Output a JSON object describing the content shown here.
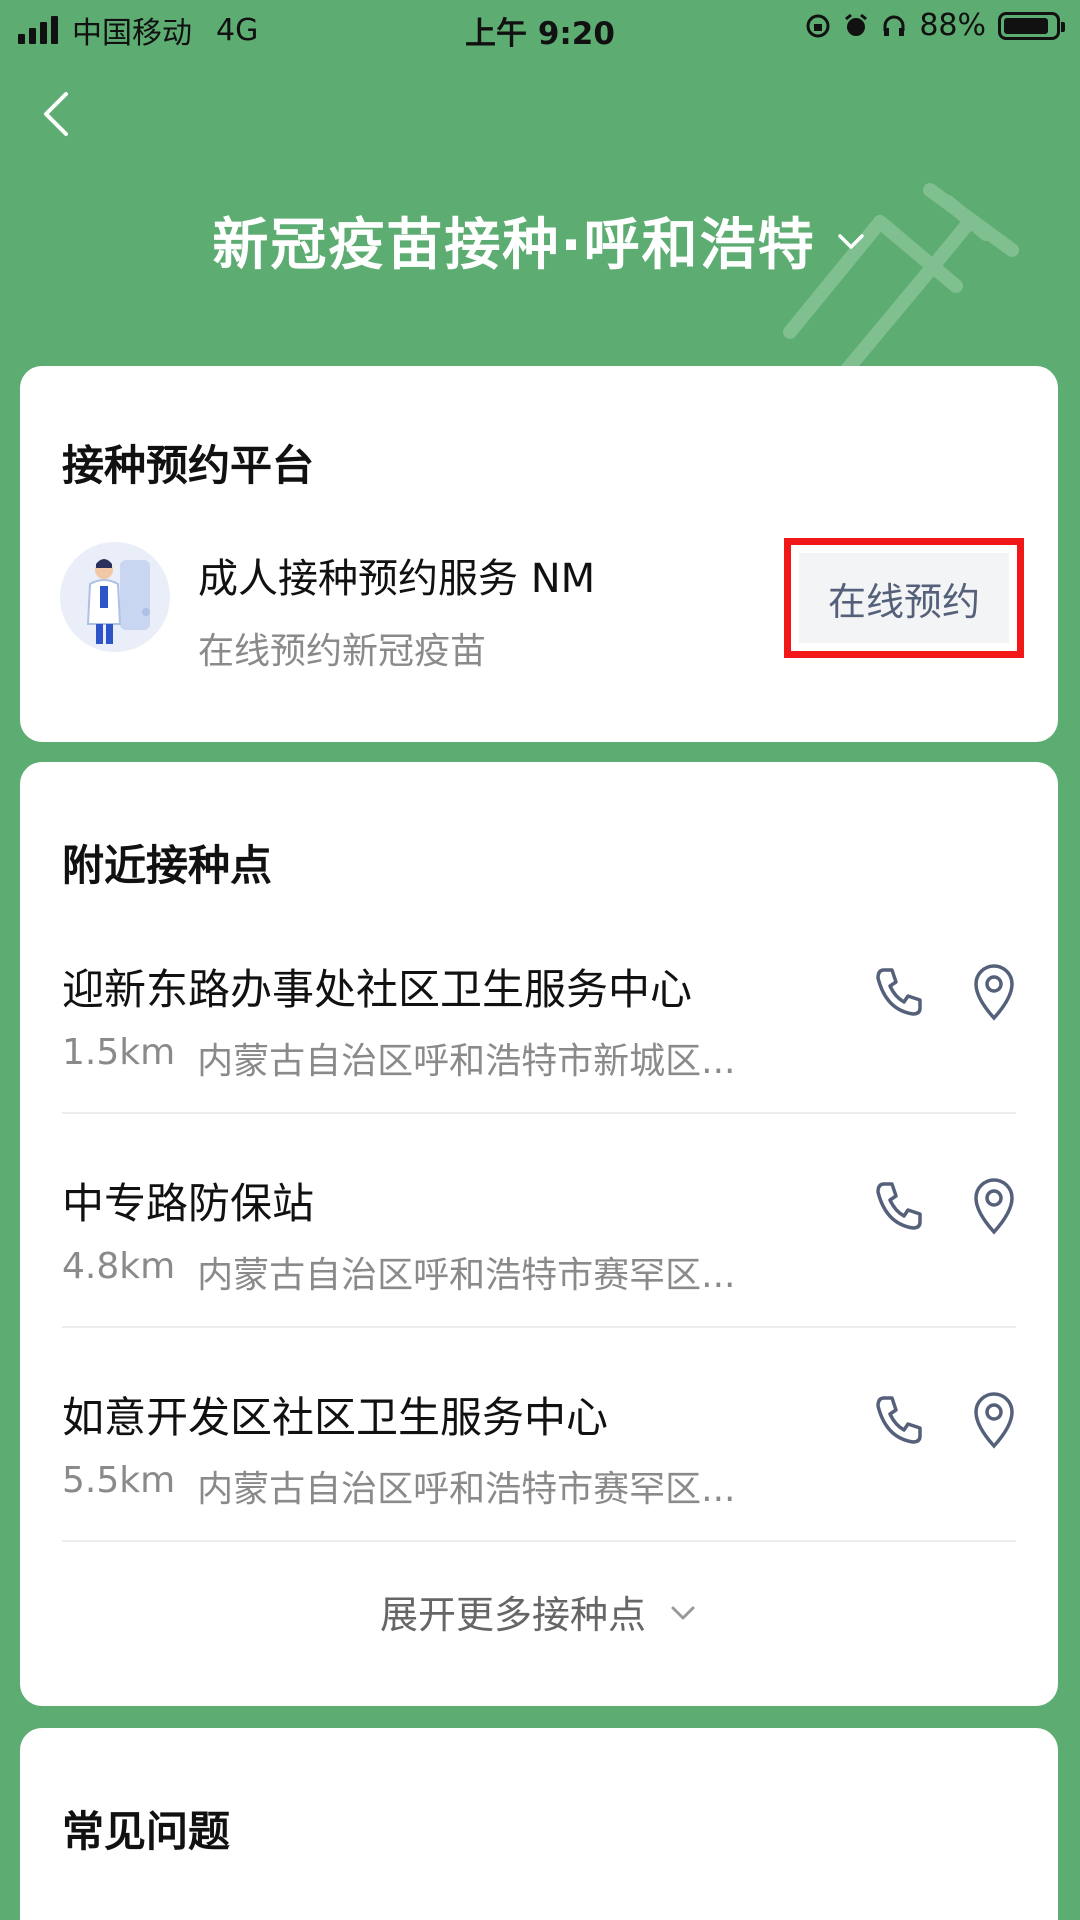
{
  "status_bar": {
    "carrier": "中国移动",
    "network": "4G",
    "time": "上午 9:20",
    "battery": "88%"
  },
  "header": {
    "title": "新冠疫苗接种·呼和浩特"
  },
  "booking": {
    "section_title": "接种预约平台",
    "service_name": "成人接种预约服务 NM",
    "service_desc": "在线预约新冠疫苗",
    "button_label": "在线预约"
  },
  "nearby": {
    "section_title": "附近接种点",
    "sites": [
      {
        "name": "迎新东路办事处社区卫生服务中心",
        "distance": "1.5km",
        "address": "内蒙古自治区呼和浩特市新城区..."
      },
      {
        "name": "中专路防保站",
        "distance": "4.8km",
        "address": "内蒙古自治区呼和浩特市赛罕区..."
      },
      {
        "name": "如意开发区社区卫生服务中心",
        "distance": "5.5km",
        "address": "内蒙古自治区呼和浩特市赛罕区..."
      }
    ],
    "expand_label": "展开更多接种点"
  },
  "faq": {
    "section_title": "常见问题"
  },
  "colors": {
    "background": "#5DAC72",
    "highlight_border": "#F21818",
    "icon": "#55617A"
  },
  "icons": [
    "back-arrow",
    "chevron-down",
    "syringe",
    "phone",
    "location-pin"
  ]
}
